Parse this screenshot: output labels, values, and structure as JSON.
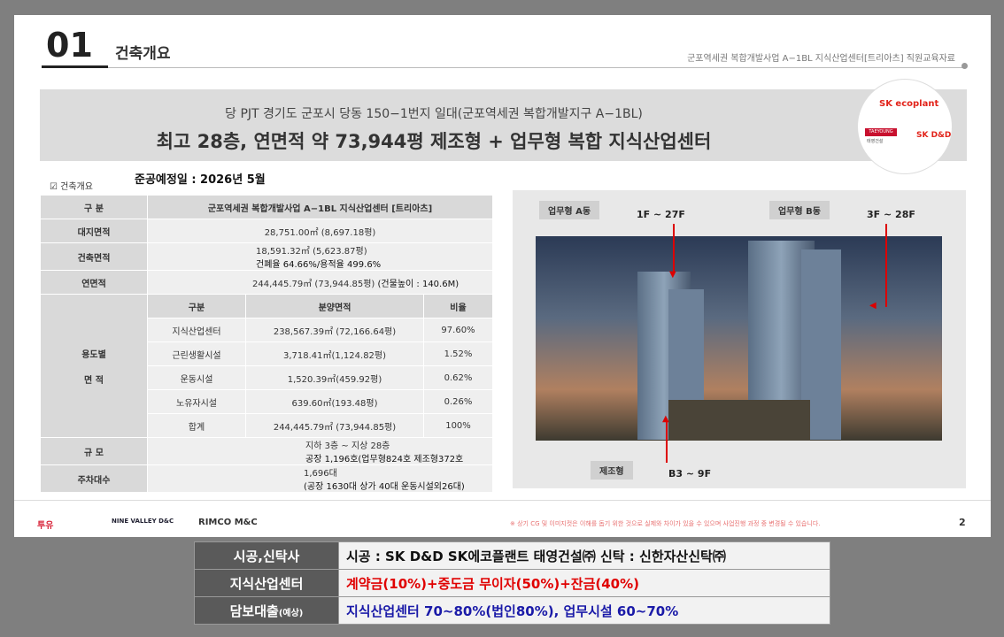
{
  "header": {
    "section_number": "01",
    "section_title": "건축개요",
    "doc_title": "군포역세권 복합개발사업 A−1BL 지식산업센터[트리아츠] 직원교육자료"
  },
  "banner": {
    "line1": "당 PJT 경기도 군포시 당동 150−1번지 일대(군포역세권 복합개발지구 A−1BL)",
    "line2": "최고 28층, 연면적 약 73,944평 제조형 + 업무형 복합 지식산업센터"
  },
  "logos": {
    "sk_ecoplant": "SK ecoplant",
    "taeyoung": "TAEYOUNG",
    "taeyoung_sub": "태영건설",
    "sk_dd": "SK D&D"
  },
  "overview": {
    "label": "건축개요",
    "completion": "준공예정일 : 2026년  5월",
    "rows": {
      "gubun_label": "구 분",
      "gubun_value": "군포역세권 복합개발사업 A−1BL 지식산업센터 [트리아츠]",
      "site_label": "대지면적",
      "site_value": "28,751.00㎡ (8,697.18평)",
      "bldg_label": "건축면적",
      "bldg_value": "18,591.32㎡ (5,623.87평)",
      "bldg_note": "건폐율 64.66%/용적율 499.6%",
      "gfa_label": "연면적",
      "gfa_value": "244,445.79㎡ (73,944.85평)",
      "gfa_note": "(건물높이 : 140.6M)",
      "use_label_1": "용도별",
      "use_label_2": "면 적",
      "scale_label": "규 모",
      "scale_value": "지하 3층 ~ 지상 28층",
      "scale_note": "공장 1,196호(업무형824호  제조형372호",
      "parking_label": "주차대수",
      "parking_value": "1,696대",
      "parking_note": "(공장 1630대 상가 40대 운동시설외26대)"
    },
    "use_table": {
      "headers": [
        "구분",
        "분양면적",
        "비율"
      ],
      "rows": [
        [
          "지식산업센터",
          "238,567.39㎡ (72,166.64평)",
          "97.60%"
        ],
        [
          "근린생활시설",
          "3,718.41㎡(1,124.82평)",
          "1.52%"
        ],
        [
          "운동시설",
          "1,520.39㎡(459.92평)",
          "0.62%"
        ],
        [
          "노유자시설",
          "639.60㎡(193.48평)",
          "0.26%"
        ],
        [
          "합계",
          "244,445.79㎡ (73,944.85평)",
          "100%"
        ]
      ]
    }
  },
  "rendering": {
    "tag_a": "업무형 A동",
    "floors_a": "1F ~ 27F",
    "tag_b": "업무형 B동",
    "floors_b": "3F ~ 28F",
    "tag_m": "제조형",
    "floors_m": "B3 ~ 9F"
  },
  "footer": {
    "logo1": "투유",
    "logo2": "NINE VALLEY D&C",
    "logo3": "RIMCO M&C",
    "note": "※ 상기 CG 및 이미지컷은 이해를 돕기 위한 것으로 실제와 차이가 있을 수 있으며 사업진행 과정 중 변경될 수 있습니다.",
    "page": "2"
  },
  "summary": [
    {
      "label": "시공,신탁사",
      "value": "시공 :  SK D&D SK에코플랜트 태영건설㈜ 신탁 : 신한자산신탁㈜",
      "color": "#111111"
    },
    {
      "label": "지식산업센터",
      "value": "계약금(10%)+중도금 무이자(50%)+잔금(40%)",
      "color": "#e00000"
    },
    {
      "label": "담보대출",
      "label_small": "(예상)",
      "value": "지식산업센터 70~80%(법인80%), 업무시설 60~70%",
      "color": "#1a1aa8"
    }
  ]
}
